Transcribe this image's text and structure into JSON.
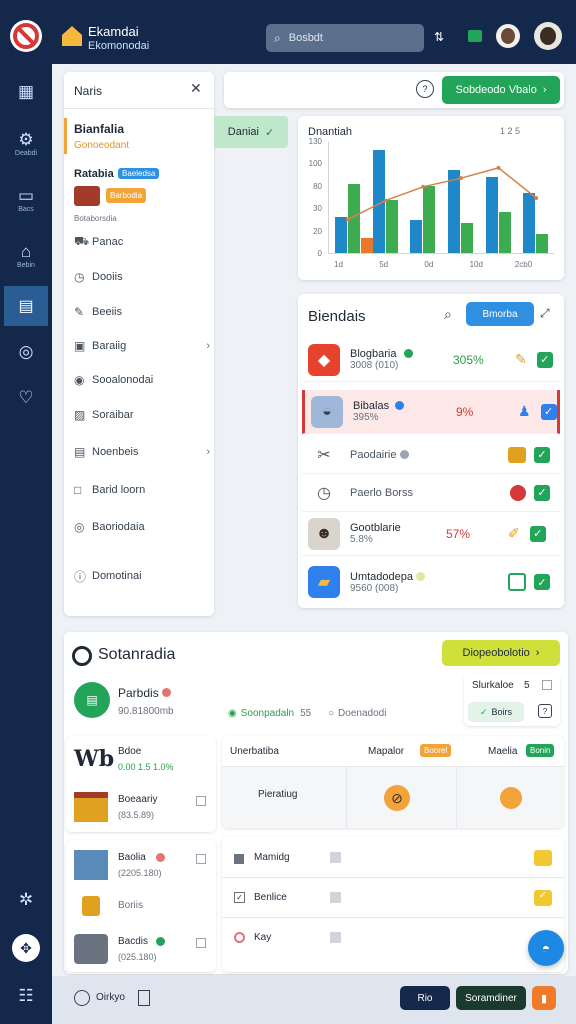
{
  "topbar": {
    "app_title": "Ekamdai",
    "app_subtitle": "Ekomonodai",
    "search_placeholder": "Bosbdt",
    "logo_icon": "no-entry-icon",
    "accent": "#1a7fd4"
  },
  "rail": {
    "items": [
      {
        "icon": "grid-icon",
        "label": ""
      },
      {
        "icon": "gear-icon",
        "label": "Deabdi"
      },
      {
        "icon": "card-icon",
        "label": "Bacs"
      },
      {
        "icon": "home-icon",
        "label": "Bebin"
      },
      {
        "icon": "doc-icon",
        "label": ""
      },
      {
        "icon": "compass-icon",
        "label": ""
      },
      {
        "icon": "shield-icon",
        "label": ""
      }
    ]
  },
  "nav_panel": {
    "title": "Naris",
    "section_title": "Bianfalia",
    "section_sub": "Gonoeodant",
    "profile_label": "Ratabia",
    "profile_badge": "Baeledsa",
    "profile_tag": "Barbodia",
    "profile_caption": "Botaborsdia",
    "items": [
      {
        "icon": "cart-icon",
        "label": "Panac",
        "chevron": false
      },
      {
        "icon": "clock-icon",
        "label": "Dooiis",
        "chevron": false
      },
      {
        "icon": "pen-icon",
        "label": "Beeiis",
        "chevron": false
      },
      {
        "icon": "box-icon",
        "label": "Baraiig",
        "chevron": true
      },
      {
        "icon": "circle-icon",
        "label": "Sooalonodai",
        "chevron": false
      },
      {
        "icon": "image-icon",
        "label": "Soraibar",
        "chevron": false
      },
      {
        "icon": "doc-icon",
        "label": "Noenbeis",
        "chevron": true
      },
      {
        "icon": "square-icon",
        "label": "Barid loorn",
        "chevron": false
      },
      {
        "icon": "target-icon",
        "label": "Baoriodaia",
        "chevron": false
      },
      {
        "icon": "info-icon",
        "label": "Domotinai",
        "chevron": false
      }
    ]
  },
  "header_strip": {
    "action_label": "Sobdeodo Vbalo"
  },
  "chip": {
    "label": "Daniai"
  },
  "chart_data": {
    "type": "bar",
    "title": "Dnantiah",
    "legend_text": "1 2 5",
    "categories": [
      "1d",
      "5d",
      "0d",
      "10d",
      "2cb0"
    ],
    "yticks": [
      "130",
      "100",
      "80",
      "30",
      "20",
      "0"
    ],
    "ylim": [
      0,
      130
    ],
    "series": [
      {
        "color": "#1e88c8",
        "values": [
          42,
          120,
          38,
          96,
          88,
          70
        ]
      },
      {
        "color": "#3dab4f",
        "values": [
          80,
          62,
          78,
          35,
          48,
          22
        ]
      },
      {
        "color": "#e8792a",
        "values": [
          18,
          0,
          0,
          0,
          0,
          0
        ]
      }
    ],
    "line_series": {
      "color": "#d6804a",
      "values": [
        40,
        62,
        78,
        88,
        100,
        65
      ]
    }
  },
  "list_panel": {
    "title": "Biendais",
    "button_label": "Bmorba",
    "rows": [
      {
        "icon": "map-icon",
        "name": "Blogbaria",
        "sub": "3008 (010)",
        "value": "305%",
        "value_color": "#2a9d4a",
        "dot": "#22a559",
        "action_icon": "pin-icon",
        "highlight": false
      },
      {
        "icon": "dish-icon",
        "name": "Bibalas",
        "sub": "395%",
        "value": "9%",
        "value_color": "#d43838",
        "dot": "#2f80ed",
        "action_icon": "person-icon",
        "highlight": true
      },
      {
        "icon": "scissors-icon",
        "name": "Paodairie",
        "sub": "",
        "value": "",
        "value_color": "#2a9d4a",
        "dot": "#9ca3af",
        "action_icon": "box-icon",
        "highlight": false
      },
      {
        "icon": "clock-icon",
        "name": "Paerlo Borss",
        "sub": "",
        "value": "",
        "value_color": "#2a9d4a",
        "dot": "",
        "action_icon": "ball-icon",
        "highlight": false
      },
      {
        "icon": "face-icon",
        "name": "Gootblarie",
        "sub": "5.8%",
        "value": "57%",
        "value_color": "#d43838",
        "dot": "",
        "action_icon": "brush-icon",
        "highlight": false
      },
      {
        "icon": "folder-icon",
        "name": "Umtadodepa",
        "sub": "9560 (008)",
        "value": "",
        "value_color": "#2a9d4a",
        "dot": "#e3e6a0",
        "action_icon": "grid-icon",
        "highlight": false
      }
    ]
  },
  "bottom_panel": {
    "title": "Sotanradia",
    "action_label": "Diopeobolotio",
    "summary_name": "Parbdis",
    "summary_sub": "90.81800mb",
    "status_green": "Soonpadaln",
    "status_count": "55",
    "status_gray": "Doenadodi",
    "side_label": "Slurkaloe",
    "side_value": "5",
    "side_button": "Boirs",
    "left_cards": [
      {
        "icon": "logo-icon",
        "name": "Bdoe",
        "sub": "0.00 1.5 1.0%"
      },
      {
        "icon": "building-icon",
        "name": "Boeaariy",
        "sub": "(83.5.89)"
      },
      {
        "icon": "city-icon",
        "name": "Baolia",
        "sub": "(2205.180)"
      },
      {
        "icon": "tool-icon",
        "name": "Boriis",
        "sub": ""
      },
      {
        "icon": "car-icon",
        "name": "Bacdis",
        "sub": "(025.180)"
      }
    ],
    "table_headers": [
      "Unerbatiba",
      "Mapalor",
      "Maelia"
    ],
    "header_badges": [
      "Boorel",
      "Bonin"
    ],
    "table_row_label": "Pieratiug",
    "bottom_rows": [
      {
        "icon": "box-icon",
        "label": "Mamidg"
      },
      {
        "icon": "check-icon",
        "label": "Benlice"
      },
      {
        "icon": "target-icon",
        "label": "Kay"
      }
    ]
  },
  "footer": {
    "clock_label": "Oirkyo",
    "btn1": "Rio",
    "btn2": "Soramdiner"
  }
}
